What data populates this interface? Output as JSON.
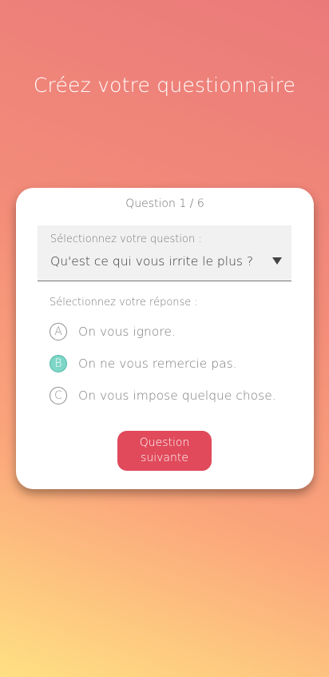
{
  "page": {
    "title": "Créez votre questionnaire"
  },
  "card": {
    "counter": "Question 1 / 6",
    "question_select": {
      "label": "Sélectionnez votre question :",
      "value": "Qu'est ce qui vous irrite le plus ?"
    },
    "answer_label": "Sélectionnez votre réponse :",
    "options": [
      {
        "letter": "A",
        "text": "On vous ignore.",
        "selected": false
      },
      {
        "letter": "B",
        "text": "On ne vous remercie pas.",
        "selected": true
      },
      {
        "letter": "C",
        "text": "On vous impose quelque chose.",
        "selected": false
      }
    ],
    "next_button_label": "Question suivante"
  },
  "colors": {
    "accent_button": "#e04a5b",
    "selected_badge": "#7dd6c7",
    "gradient_top": "#ea7a7a",
    "gradient_bottom": "#ffe083"
  }
}
